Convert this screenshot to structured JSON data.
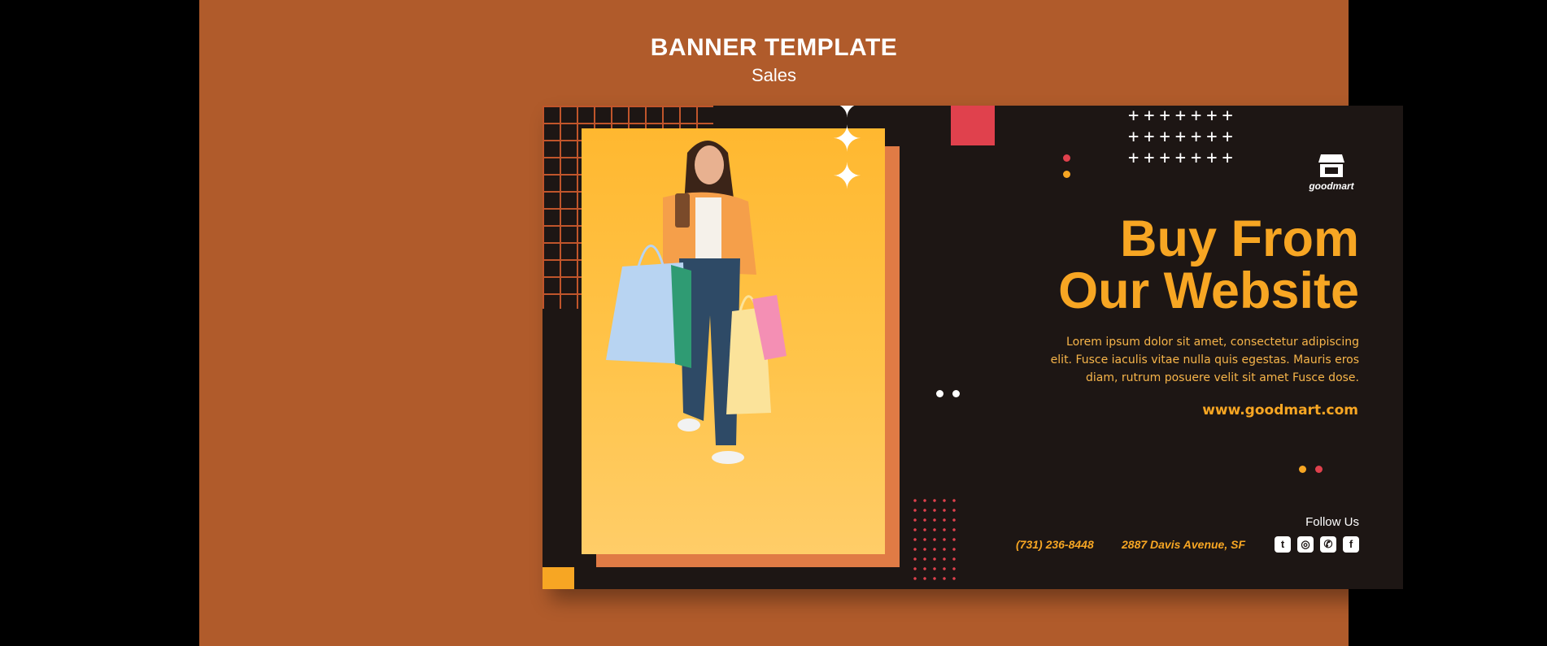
{
  "header": {
    "title": "BANNER TEMPLATE",
    "subtitle": "Sales"
  },
  "banner": {
    "brand": "goodmart",
    "headline_line1": "Buy From",
    "headline_line2": "Our Website",
    "body_line1": "Lorem ipsum dolor sit amet, consectetur adipiscing",
    "body_line2": "elit. Fusce iaculis vitae nulla quis egestas. Mauris eros",
    "body_line3": "diam, rutrum posuere velit sit amet Fusce dose.",
    "website": "www.goodmart.com",
    "follow_label": "Follow Us",
    "phone": "(731) 236-8448",
    "address": "2887  Davis Avenue, SF",
    "socials": [
      "twitter-icon",
      "instagram-icon",
      "whatsapp-icon",
      "facebook-icon"
    ]
  },
  "colors": {
    "background": "#b05b2b",
    "banner": "#1d1614",
    "accent": "#f7a623",
    "red": "#e0414d"
  }
}
